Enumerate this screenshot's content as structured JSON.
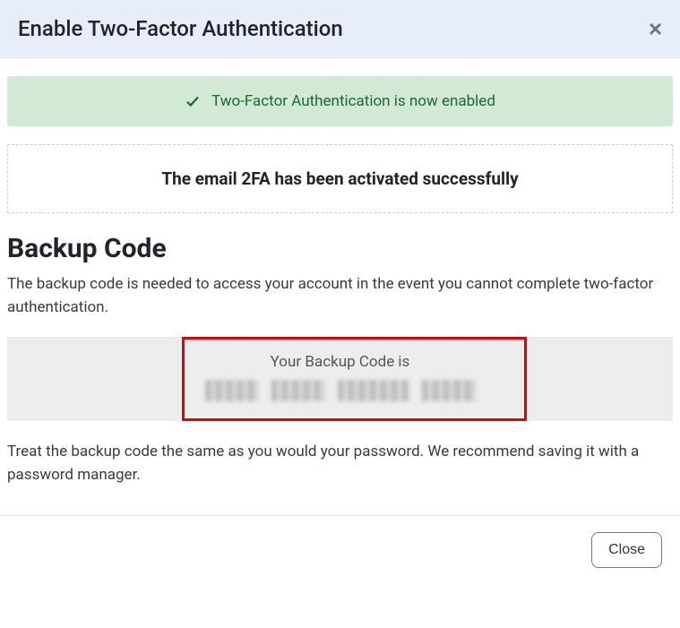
{
  "header": {
    "title": "Enable Two-Factor Authentication"
  },
  "alert": {
    "message": "Two-Factor Authentication is now enabled"
  },
  "activation": {
    "message": "The email 2FA has been activated successfully"
  },
  "backup": {
    "heading": "Backup Code",
    "description": "The backup code is needed to access your account in the event you cannot complete two-factor authentication.",
    "code_label": "Your Backup Code is",
    "code_value": "[redacted]",
    "warning": "Treat the backup code the same as you would your password. We recommend saving it with a password manager."
  },
  "footer": {
    "close_label": "Close"
  }
}
